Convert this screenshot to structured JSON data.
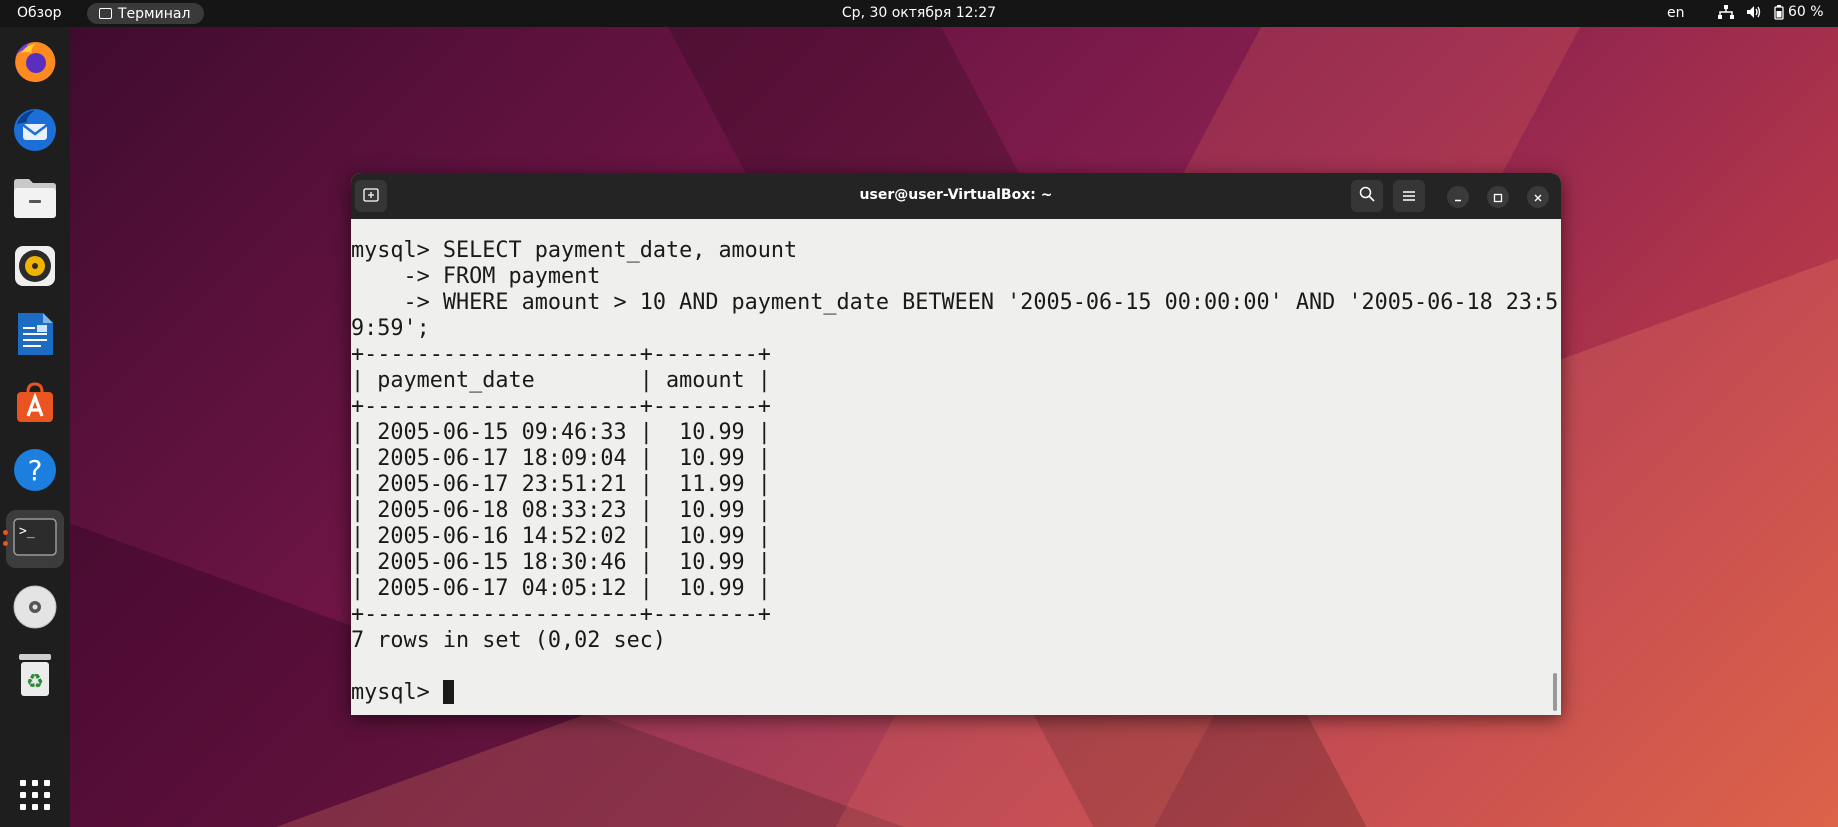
{
  "topbar": {
    "overview": "Обзор",
    "app_name": "Терминал",
    "clock": "Ср, 30 октября  12:27",
    "lang": "en",
    "battery": "60 %"
  },
  "dock": {
    "items": [
      "firefox-icon",
      "thunderbird-icon",
      "files-icon",
      "rhythmbox-icon",
      "libreoffice-writer-icon",
      "app-center-icon",
      "help-icon",
      "terminal-icon",
      "dvd-icon",
      "trash-icon",
      "show-apps-icon"
    ]
  },
  "window": {
    "title": "user@user-VirtualBox: ~"
  },
  "terminal": {
    "line1": "mysql> SELECT payment_date, amount",
    "line2": "    -> FROM payment",
    "line3": "    -> WHERE amount > 10 AND payment_date BETWEEN '2005-06-15 00:00:00' AND '2005-06-18 23:5",
    "line4": "9:59';",
    "border": "+---------------------+--------+",
    "header": "| payment_date        | amount |",
    "rows": [
      "| 2005-06-15 09:46:33 |  10.99 |",
      "| 2005-06-17 18:09:04 |  10.99 |",
      "| 2005-06-17 23:51:21 |  11.99 |",
      "| 2005-06-18 08:33:23 |  10.99 |",
      "| 2005-06-16 14:52:02 |  10.99 |",
      "| 2005-06-15 18:30:46 |  10.99 |",
      "| 2005-06-17 04:05:12 |  10.99 |"
    ],
    "result": "7 rows in set (0,02 sec)",
    "prompt": "mysql> "
  }
}
